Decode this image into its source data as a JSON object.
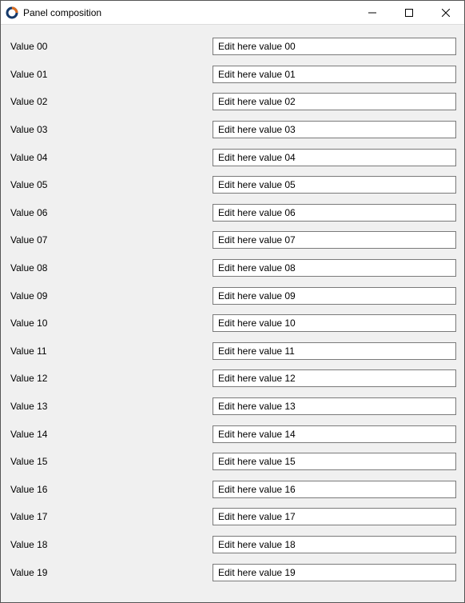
{
  "window": {
    "title": "Panel composition"
  },
  "rows": [
    {
      "label": "Value 00",
      "value": "Edit here value 00"
    },
    {
      "label": "Value 01",
      "value": "Edit here value 01"
    },
    {
      "label": "Value 02",
      "value": "Edit here value 02"
    },
    {
      "label": "Value 03",
      "value": "Edit here value 03"
    },
    {
      "label": "Value 04",
      "value": "Edit here value 04"
    },
    {
      "label": "Value 05",
      "value": "Edit here value 05"
    },
    {
      "label": "Value 06",
      "value": "Edit here value 06"
    },
    {
      "label": "Value 07",
      "value": "Edit here value 07"
    },
    {
      "label": "Value 08",
      "value": "Edit here value 08"
    },
    {
      "label": "Value 09",
      "value": "Edit here value 09"
    },
    {
      "label": "Value 10",
      "value": "Edit here value 10"
    },
    {
      "label": "Value 11",
      "value": "Edit here value 11"
    },
    {
      "label": "Value 12",
      "value": "Edit here value 12"
    },
    {
      "label": "Value 13",
      "value": "Edit here value 13"
    },
    {
      "label": "Value 14",
      "value": "Edit here value 14"
    },
    {
      "label": "Value 15",
      "value": "Edit here value 15"
    },
    {
      "label": "Value 16",
      "value": "Edit here value 16"
    },
    {
      "label": "Value 17",
      "value": "Edit here value 17"
    },
    {
      "label": "Value 18",
      "value": "Edit here value 18"
    },
    {
      "label": "Value 19",
      "value": "Edit here value 19"
    }
  ]
}
